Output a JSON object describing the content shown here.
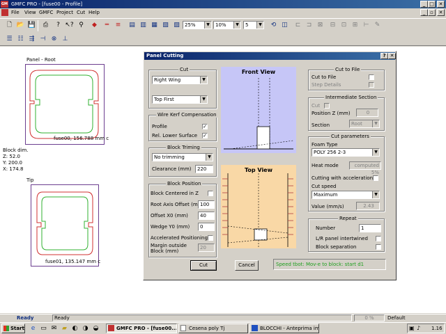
{
  "window": {
    "title": "GMFC PRO - [fuse00 - Profile]",
    "app_badge": "GM"
  },
  "menu": [
    "File",
    "View",
    "GMFC",
    "Project",
    "Cut",
    "Help"
  ],
  "toolbar": {
    "zoom1": "25%",
    "zoom2": "10%",
    "count": "5"
  },
  "left_pane": {
    "root_label": "Panel - Root",
    "root_caption": "fuse00, 156.788 mm c",
    "block_dim_label": "Block dim.",
    "block_z": "Z: 52.0",
    "block_y": "Y: 200.0",
    "block_x": "X: 174.8",
    "tip_label": "Tip",
    "tip_caption": "fuse01, 135.147 mm c"
  },
  "dialog": {
    "title": "Panel Cutting",
    "cut": {
      "label": "Cut",
      "wing": "Right Wing",
      "order": "Top First"
    },
    "wire_kerf": {
      "label": "Wire Kerf Compensation",
      "profile_label": "Profile",
      "profile_checked": "✓",
      "rel_lower_label": "Rel. Lower Surface",
      "rel_lower_checked": "✓"
    },
    "block_trimming": {
      "label": "Block Triming",
      "mode": "No trimming",
      "clearance_label": "Clearance (mm)",
      "clearance_value": "220"
    },
    "block_position": {
      "label": "Block Position",
      "centered_label": "Block Centered in Z",
      "root_axis_label": "Root Axis Offset (mm)",
      "root_axis_value": "100",
      "offset_x0_label": "Offset X0 (mm)",
      "offset_x0_value": "40",
      "wedge_y0_label": "Wedge Y0 (mm)",
      "wedge_y0_value": "0",
      "accelerated_label": "Accelerated Positioning",
      "margin_label": "Margin outside Block (mm)",
      "margin_value": "20"
    },
    "front_view_label": "Front View",
    "top_view_label": "Top View",
    "cut_to_file": {
      "label": "Cut to File",
      "cut_to_file_label": "Cut to File",
      "step_details_label": "Step Details"
    },
    "intermediate": {
      "label": "Intermediate Section",
      "cut_label": "Cut",
      "position_label": "Position Z (mm)",
      "position_value": "0",
      "section_label": "Section",
      "section_value": "Root"
    },
    "cut_params": {
      "label": "Cut parameters",
      "foam_type_label": "Foam Type",
      "foam_type_value": "POLY 256 2-3",
      "heat_mode_label": "Heat mode",
      "heat_mode_value": "computed 5%",
      "accel_label": "Cutting with acceleration",
      "speed_label": "Cut speed",
      "speed_value": "Maximum",
      "value_label": "Value (mm/s)",
      "value_value": "2.43"
    },
    "repeat": {
      "label": "Repeat",
      "number_label": "Number",
      "number_value": "1",
      "lr_label": "L/R panel intertwined",
      "block_sep_label": "Block separation"
    },
    "cut_button": "Cut",
    "cancel_button": "Cancel",
    "status_text": "Speed tbot: Mov-e to block: start d1"
  },
  "statusbar": {
    "ready_bold": "Ready",
    "ready": "Ready",
    "percent": "0 %",
    "default": "Default"
  },
  "taskbar": {
    "start": "Start",
    "items": [
      "GMFC PRO - [fuse00...",
      "Cesena poly Tj",
      "BLOCCHI - Anteprima imm..."
    ],
    "clock": "1.16"
  },
  "colors": {
    "titlebar": "#0a246a",
    "front_view_bg": "#c6c6f7",
    "top_view_bg": "#f9d8a6",
    "profile_red": "#d03030",
    "profile_green": "#30b030",
    "status_green": "#1f9f1f"
  }
}
